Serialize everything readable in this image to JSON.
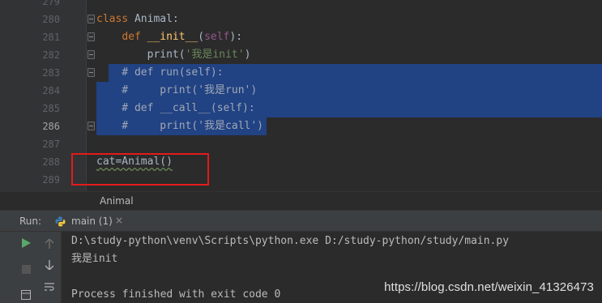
{
  "editor": {
    "line_numbers": [
      "279",
      "280",
      "281",
      "282",
      "283",
      "284",
      "285",
      "286",
      "287",
      "288",
      "289"
    ],
    "current_line": "286",
    "code": {
      "l280_kw": "class",
      "l280_name": " Animal:",
      "l281_indent": "    ",
      "l281_kw": "def",
      "l281_fn": " __init__",
      "l281_open": "(",
      "l281_self": "self",
      "l281_close": "):",
      "l282_indent": "        ",
      "l282_call": "print(",
      "l282_str": "'我是init'",
      "l282_close": ")",
      "l283": "    # def run(self):",
      "l284": "    #     print('我是run')",
      "l285": "    # def __call__(self):",
      "l286": "    #     print('我是call')",
      "l288": "cat=Animal()"
    }
  },
  "breadcrumb": {
    "label": "Animal"
  },
  "run_panel": {
    "label": "Run:",
    "tab_title": "main (1)",
    "tab_close": "×",
    "console_lines": [
      "D:\\study-python\\venv\\Scripts\\python.exe D:/study-python/study/main.py",
      "我是init",
      "",
      "Process finished with exit code 0"
    ]
  },
  "watermark": "https://blog.csdn.net/weixin_41326473",
  "colors": {
    "background": "#2b2b2b",
    "gutter": "#313335",
    "selection": "#214283",
    "keyword": "#cc7832",
    "function": "#ffc66d",
    "string": "#6a8759",
    "comment": "#808080",
    "highlight_box": "#e31b1b",
    "run_icon": "#59a869"
  },
  "icons": {
    "fold": "fold-marker-icon",
    "python": "python-icon",
    "run": "play-icon",
    "stop": "stop-icon",
    "up": "arrow-up-icon",
    "down": "arrow-down-icon",
    "wrap": "soft-wrap-icon"
  }
}
